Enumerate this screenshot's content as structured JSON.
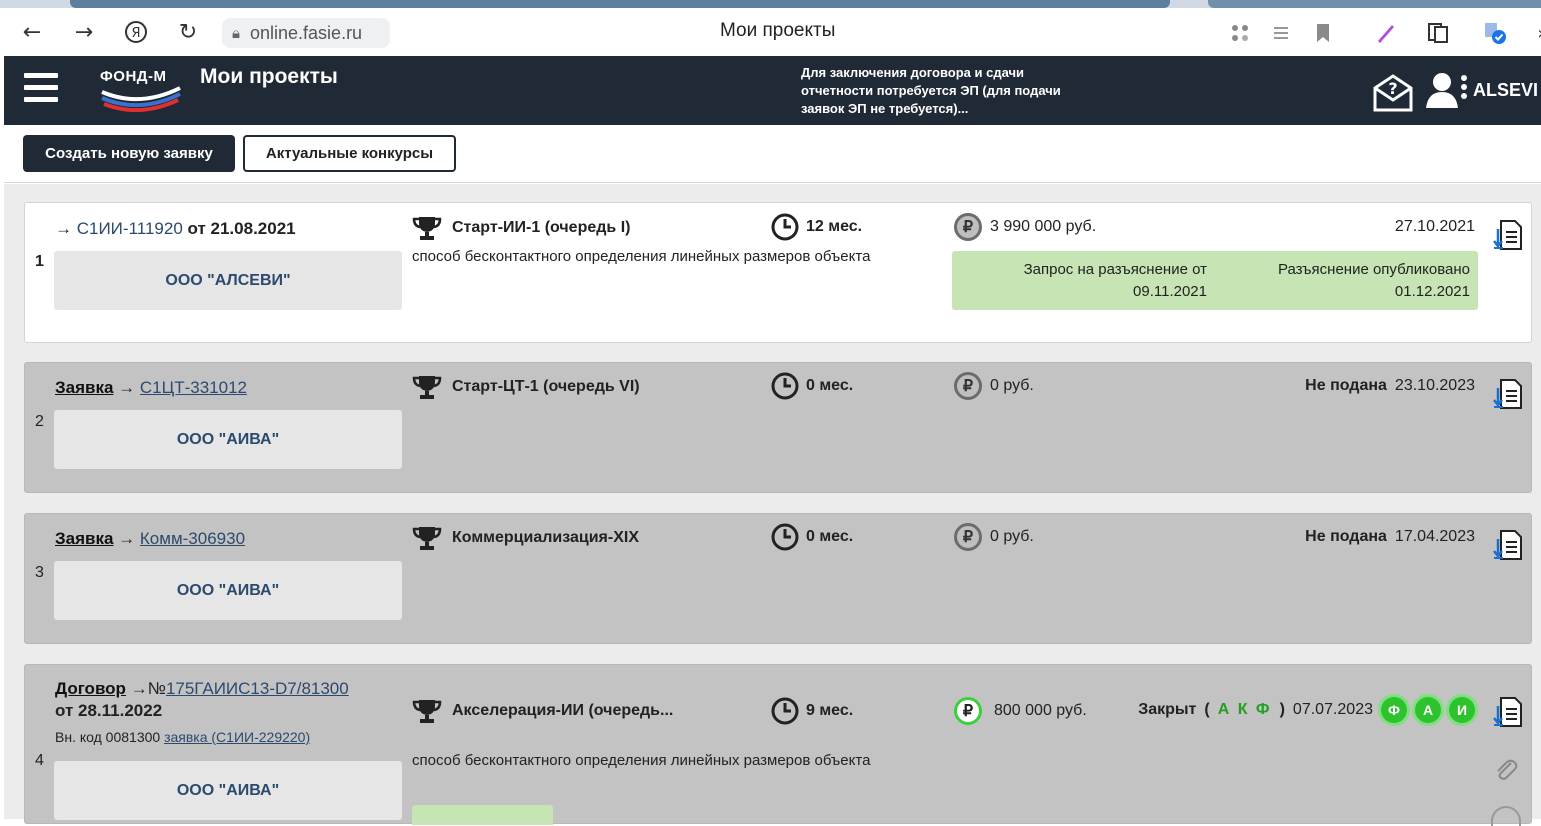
{
  "browser": {
    "url": "online.fasie.ru",
    "tab_title": "Мои проекты"
  },
  "header": {
    "logo_text": "ФОНД-М",
    "title": "Мои проекты",
    "notice": "Для заключения договора и сдачи отчетности потребуется ЭП (для подачи заявок ЭП не требуется)...",
    "user_name": "ALSEVI"
  },
  "actions": {
    "create_label": "Создать новую заявку",
    "contests_label": "Актуальные конкурсы"
  },
  "projects": [
    {
      "num": "1",
      "arrow": "→",
      "code": "С1ИИ-111920",
      "date_label": "от 21.08.2021",
      "org": "ООО \"АЛСЕВИ\"",
      "contest": "Старт-ИИ-1 (очередь I)",
      "description": "способ бесконтактного определения линейных размеров объекта",
      "duration": "12 мес.",
      "amount": "3 990 000 руб.",
      "date": "27.10.2021",
      "request_text": "Запрос на разъяснение от 09.11.2021",
      "published_text": "Разъяснение опубликовано 01.12.2021"
    },
    {
      "num": "2",
      "kind": "Заявка",
      "arrow": "→",
      "code": "С1ЦТ-331012",
      "org": "ООО \"АИВА\"",
      "contest": "Старт-ЦТ-1 (очередь VI)",
      "duration": "0 мес.",
      "amount": "0 руб.",
      "status": "Не подана",
      "date": "23.10.2023"
    },
    {
      "num": "3",
      "kind": "Заявка",
      "arrow": "→",
      "code": "Комм-306930",
      "org": "ООО \"АИВА\"",
      "contest": "Коммерциализация-XIX",
      "duration": "0 мес.",
      "amount": "0 руб.",
      "status": "Не подана",
      "date": "17.04.2023"
    },
    {
      "num": "4",
      "kind": "Договор",
      "arrow": "→",
      "code_prefix": "№",
      "code": "175ГАИИС13-D7/81300",
      "date_label": "от 28.11.2022",
      "internal_code_label": "Вн. код 0081300",
      "internal_link": "заявка (С1ИИ-229220)",
      "org": "ООО \"АИВА\"",
      "contest": "Акселерация-ИИ (очередь...",
      "description": "способ бесконтактного определения линейных размеров объекта",
      "duration": "9 мес.",
      "amount": "800 000 руб.",
      "status": "Закрыт",
      "status_open": "(",
      "status_letters": "А К Ф",
      "status_close": ")",
      "date": "07.07.2023",
      "badges": [
        "Ф",
        "А",
        "И"
      ]
    }
  ],
  "icons": {
    "ruble": "₽",
    "colors": {
      "header_bg": "#1f2a36",
      "org_text": "#2c4a6e",
      "green_box": "#c7e5b4",
      "badge_green": "#2fc22f"
    }
  }
}
